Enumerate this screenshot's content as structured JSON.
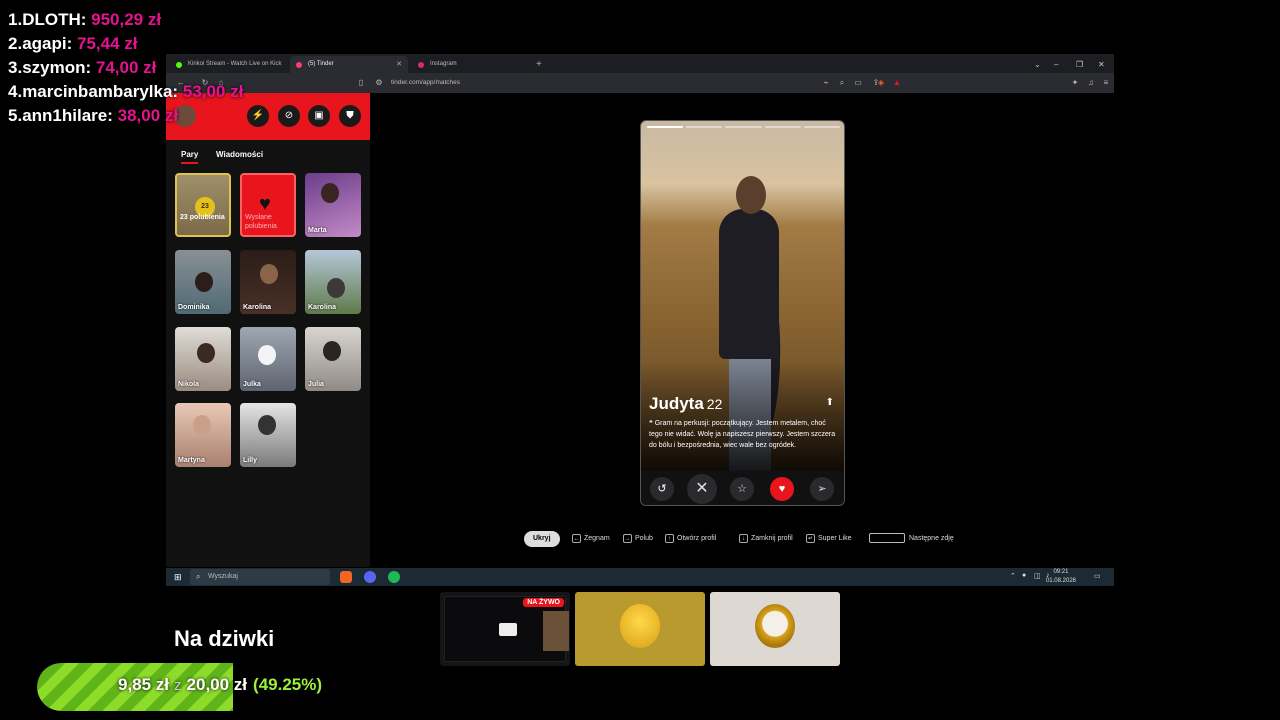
{
  "leaderboard": [
    {
      "rank": "1.",
      "name": "DLOTH:",
      "amount": "950,29 zł"
    },
    {
      "rank": "2.",
      "name": "agapi:",
      "amount": "75,44 zł"
    },
    {
      "rank": "3.",
      "name": "szymon:",
      "amount": "74,00 zł"
    },
    {
      "rank": "4.",
      "name": "marcinbambarylka:",
      "amount": "53,00 zł"
    },
    {
      "rank": "5.",
      "name": "ann1hilare:",
      "amount": "38,00 zł"
    }
  ],
  "browser": {
    "tabs": [
      {
        "label": "Kinkoi Stream - Watch Live on Kick"
      },
      {
        "label": "(5) Tinder"
      },
      {
        "label": "Instagram"
      }
    ],
    "url": "tinder.com/app/matches"
  },
  "sidebar": {
    "tabs": {
      "pairs": "Pary",
      "messages": "Wiadomości"
    },
    "likes_card": {
      "count": "23",
      "label": "23 polubienia"
    },
    "sent_card": {
      "label": "Wysłane polubienia"
    },
    "matches": [
      {
        "name": "Marta"
      },
      {
        "name": "Dominika"
      },
      {
        "name": "Karolina"
      },
      {
        "name": "Karolina"
      },
      {
        "name": "Nikola"
      },
      {
        "name": "Julka"
      },
      {
        "name": "Julia"
      },
      {
        "name": "Martyna"
      },
      {
        "name": "Lilly"
      }
    ]
  },
  "profile": {
    "name": "Judyta",
    "age": "22",
    "bio": "❝ Gram na perkusji: początkujący. Jestem metalem, choć tego nie widać. Wolę ja napiszesz pierwszy. Jestem szczera do bólu i bezpośrednia, wiec wale bez ogródek."
  },
  "hints": {
    "hide": "Ukryj",
    "nope": "Żegnam",
    "like": "Polub",
    "open": "Otwórz profil",
    "close": "Zamknij profil",
    "superlike": "Super Like",
    "next_photo": "Następne zdję"
  },
  "taskbar": {
    "search_placeholder": "Wyszukaj",
    "time": "09:21",
    "date": "01.08.2026"
  },
  "goal": {
    "title": "Na dziwki",
    "current": "9,85 zł",
    "separator": "z",
    "target": "20,00 zł",
    "percent_label": "(49.25%)",
    "progress_fraction": 0.4925
  },
  "live_thumb": {
    "badge": "NA ŻYWO"
  },
  "colors": {
    "tinder_red": "#e8151c",
    "donor_amount": "#e4138f",
    "goal_green": "#8ddc2a",
    "likes_gold": "#e6c11c"
  }
}
